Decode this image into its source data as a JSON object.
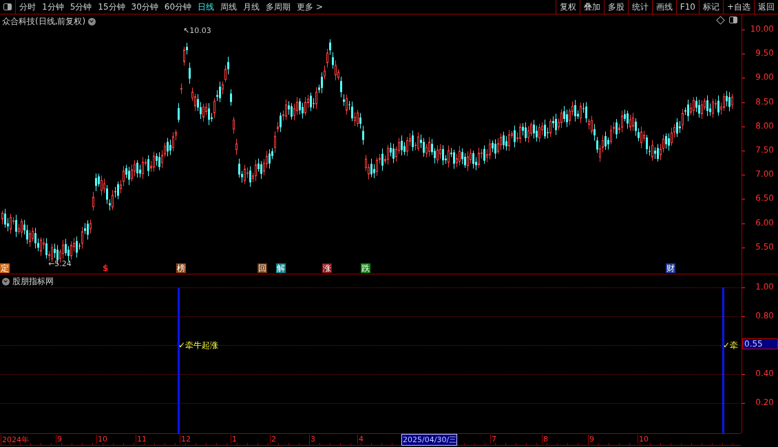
{
  "toolbar": {
    "periods": [
      {
        "label": "分时",
        "selected": false
      },
      {
        "label": "1分钟",
        "selected": false
      },
      {
        "label": "5分钟",
        "selected": false
      },
      {
        "label": "15分钟",
        "selected": false
      },
      {
        "label": "30分钟",
        "selected": false
      },
      {
        "label": "60分钟",
        "selected": false
      },
      {
        "label": "日线",
        "selected": true
      },
      {
        "label": "周线",
        "selected": false
      },
      {
        "label": "月线",
        "selected": false
      },
      {
        "label": "多周期",
        "selected": false
      },
      {
        "label": "更多 >",
        "selected": false
      }
    ],
    "buttons": [
      "复权",
      "叠加",
      "多股",
      "统计",
      "画线",
      "F10",
      "标记",
      "+自选",
      "返回"
    ]
  },
  "main_chart": {
    "title": "众合科技(日线,前复权)",
    "high_label": "↖10.03",
    "low_label": "←5.24",
    "y_ticks": [
      "10.00",
      "9.50",
      "9.00",
      "8.50",
      "8.00",
      "7.50",
      "7.00",
      "6.50",
      "6.00",
      "5.50"
    ],
    "markers": [
      {
        "text": "定",
        "color": "#c86414"
      },
      {
        "text": "$",
        "color": "#000000"
      },
      {
        "text": "榜",
        "color": "#8c4614"
      },
      {
        "text": "回",
        "color": "#6e3c14"
      },
      {
        "text": "解",
        "color": "#14828c"
      },
      {
        "text": "涨",
        "color": "#8c1414"
      },
      {
        "text": "跌",
        "color": "#148c14"
      },
      {
        "text": "财",
        "color": "#1e3c96"
      }
    ]
  },
  "indicator": {
    "title": "股朋指标网",
    "y_ticks": [
      "1.00",
      "0.80",
      "0.40",
      "0.20"
    ],
    "signals": [
      "✓牵牛起涨",
      "✓牵"
    ],
    "value": "0.55"
  },
  "x_axis": {
    "labels": [
      "2024年",
      "9",
      "10",
      "11",
      "12",
      "1",
      "2",
      "3",
      "4",
      "7",
      "8",
      "9",
      "10"
    ],
    "cursor_date": "2025/04/30/三"
  }
}
